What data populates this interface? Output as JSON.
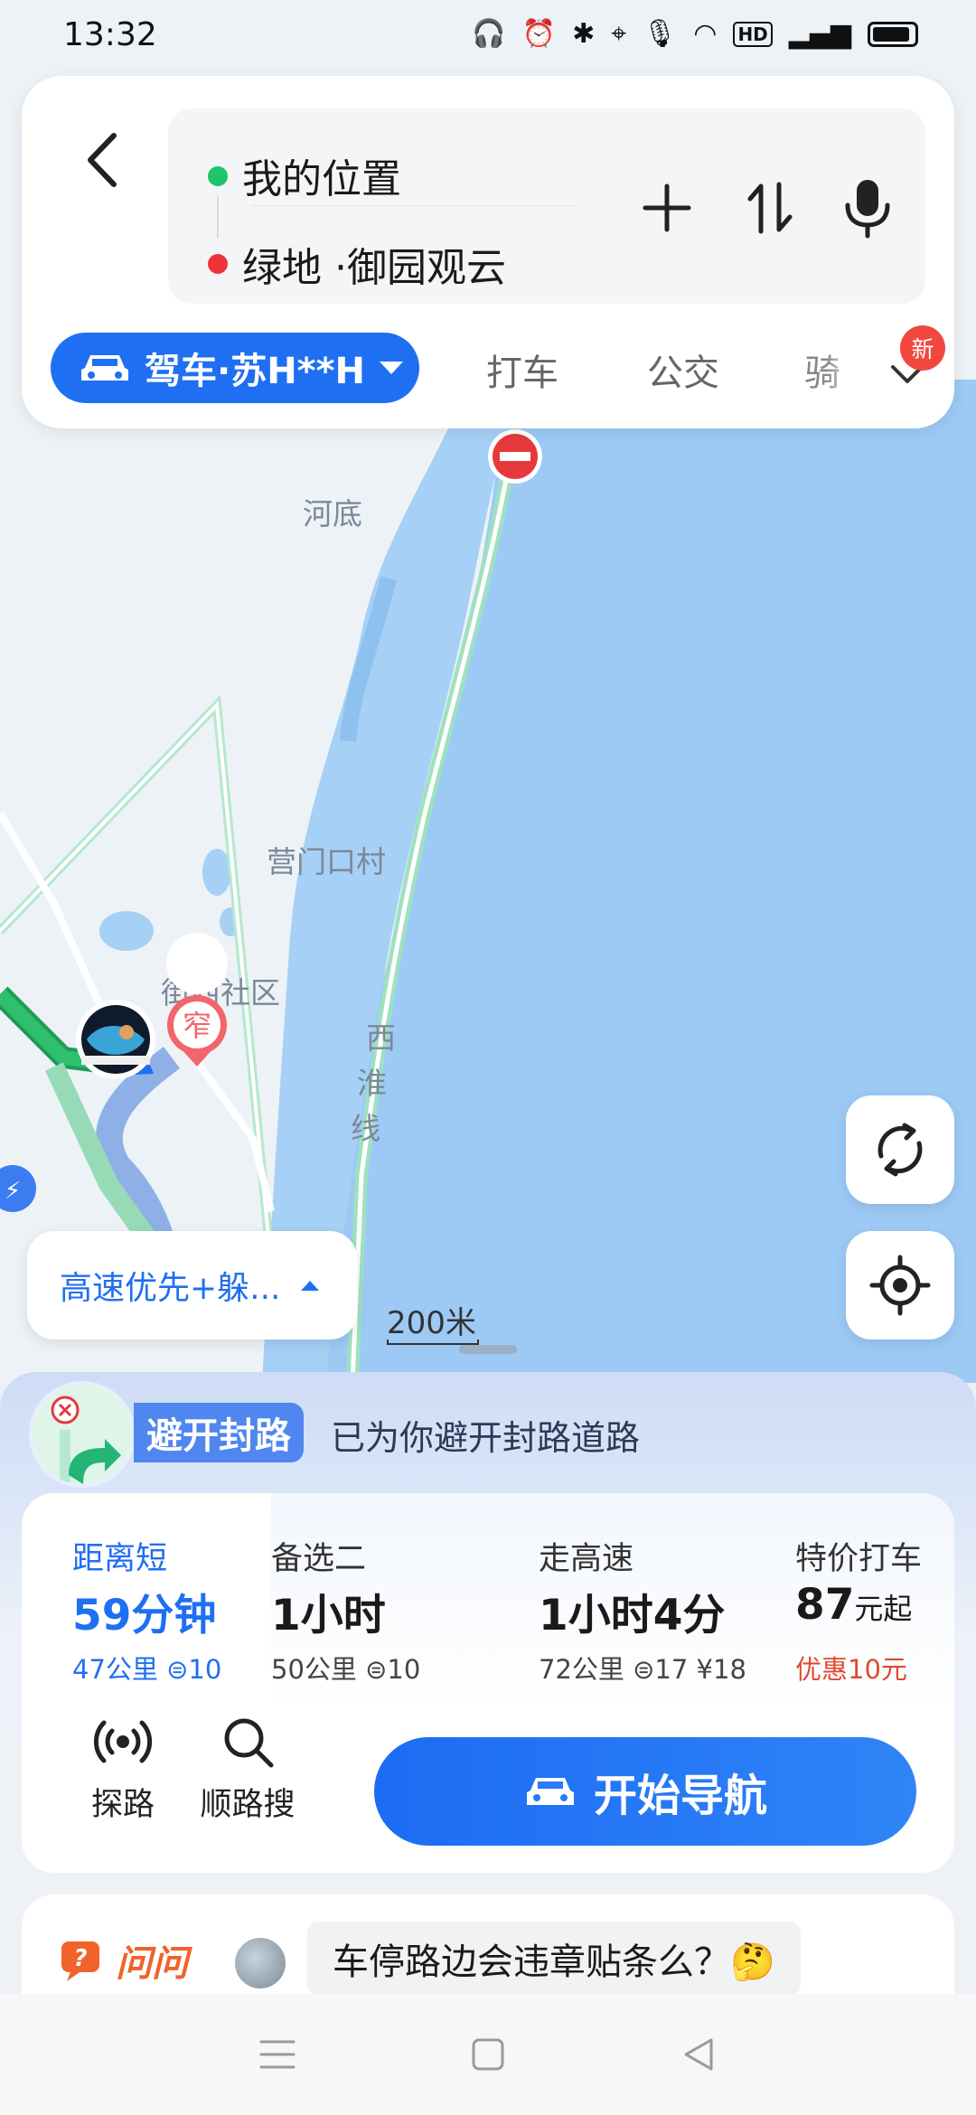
{
  "status_bar": {
    "time": "13:32",
    "icons": [
      "headset-icon",
      "alarm-icon",
      "bluetooth-icon",
      "location-icon",
      "mic-icon",
      "wifi-icon",
      "hd-icon",
      "signal-4g-icon",
      "battery-icon"
    ]
  },
  "search": {
    "origin": "我的位置",
    "destination": "绿地 ·御园观云"
  },
  "modes": {
    "selected": "驾车·苏H**H",
    "taxi": "打车",
    "bus": "公交",
    "bike": "骑",
    "new_badge": "新"
  },
  "map": {
    "labels": [
      "河底",
      "营门口村",
      "街西社区",
      "西",
      "淮",
      "线"
    ],
    "narrow_badge": "窄",
    "scale": "200米",
    "preference": "高速优先+躲..."
  },
  "avoid": {
    "tag": "避开封路",
    "message": "已为你避开封路道路"
  },
  "routes": [
    {
      "name": "距离短",
      "time": "59分钟",
      "detail": "47公里 ⊜10",
      "selected": true
    },
    {
      "name": "备选二",
      "time": "1小时",
      "detail": "50公里 ⊜10",
      "selected": false
    },
    {
      "name": "走高速",
      "time": "1小时4分",
      "detail": "72公里 ⊜17 ¥18",
      "selected": false
    },
    {
      "name": "特价打车",
      "price": "87",
      "price_unit": "元起",
      "discount": "优惠10元",
      "selected": false
    }
  ],
  "actions": {
    "probe": "探路",
    "along": "顺路搜",
    "start_nav": "开始导航"
  },
  "ask": {
    "logo": "问问",
    "question": "车停路边会违章贴条么？🤔"
  },
  "colors": {
    "accent": "#1f6ff2",
    "water": "#9ccaf5",
    "road_green": "#9fe0c0",
    "discount": "#e2492f"
  }
}
